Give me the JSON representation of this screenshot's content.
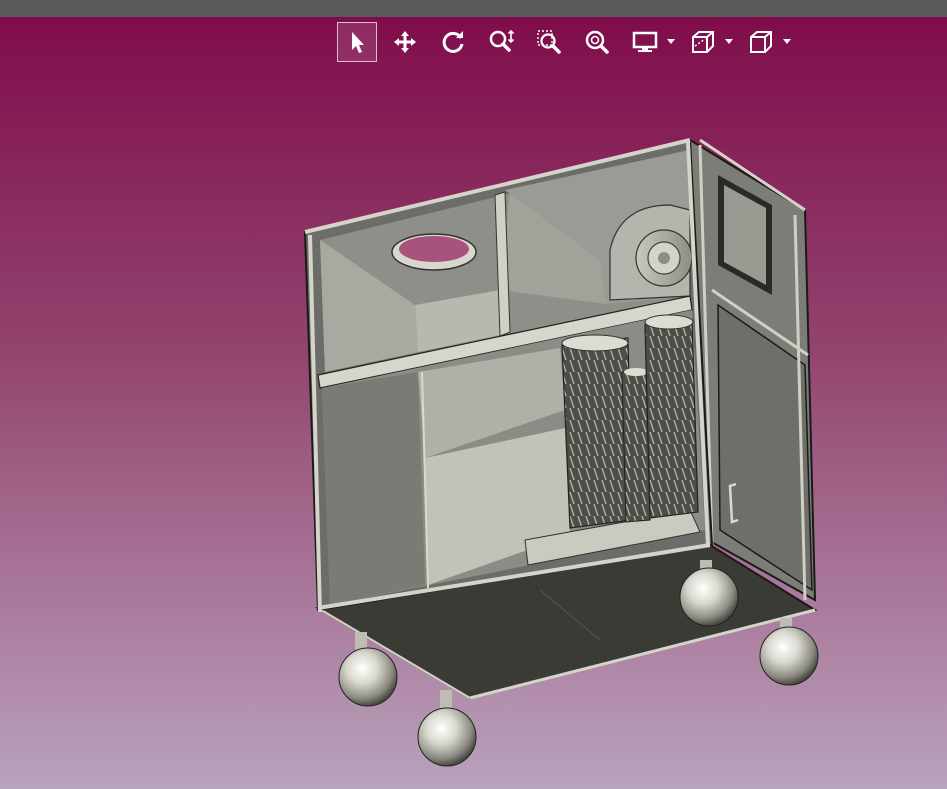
{
  "app": {
    "title_bar": "",
    "accent_color": "#ffffff",
    "background_top": "#7e0a49",
    "background_bottom": "#b8a3bc"
  },
  "toolbar": {
    "tools": [
      {
        "id": "select",
        "icon": "pointer-arrow-icon",
        "tooltip": "",
        "active": true
      },
      {
        "id": "pan",
        "icon": "pan-move-icon",
        "tooltip": "",
        "active": false
      },
      {
        "id": "rotate",
        "icon": "rotate-icon",
        "tooltip": "",
        "active": false
      },
      {
        "id": "zoom",
        "icon": "zoom-dynamic-icon",
        "tooltip": "",
        "active": false
      },
      {
        "id": "zoom-window",
        "icon": "zoom-window-icon",
        "tooltip": "",
        "active": false
      },
      {
        "id": "zoom-fit",
        "icon": "zoom-fit-icon",
        "tooltip": "",
        "active": false
      },
      {
        "id": "display-mode",
        "icon": "monitor-icon",
        "tooltip": "",
        "has_dropdown": true
      },
      {
        "id": "section-view",
        "icon": "section-view-icon",
        "tooltip": "",
        "has_dropdown": true
      },
      {
        "id": "standard-views",
        "icon": "cube-view-icon",
        "tooltip": "",
        "has_dropdown": true
      }
    ]
  },
  "viewport": {
    "model": "3d-cabinet-model",
    "render_style": "shaded-with-edges"
  }
}
